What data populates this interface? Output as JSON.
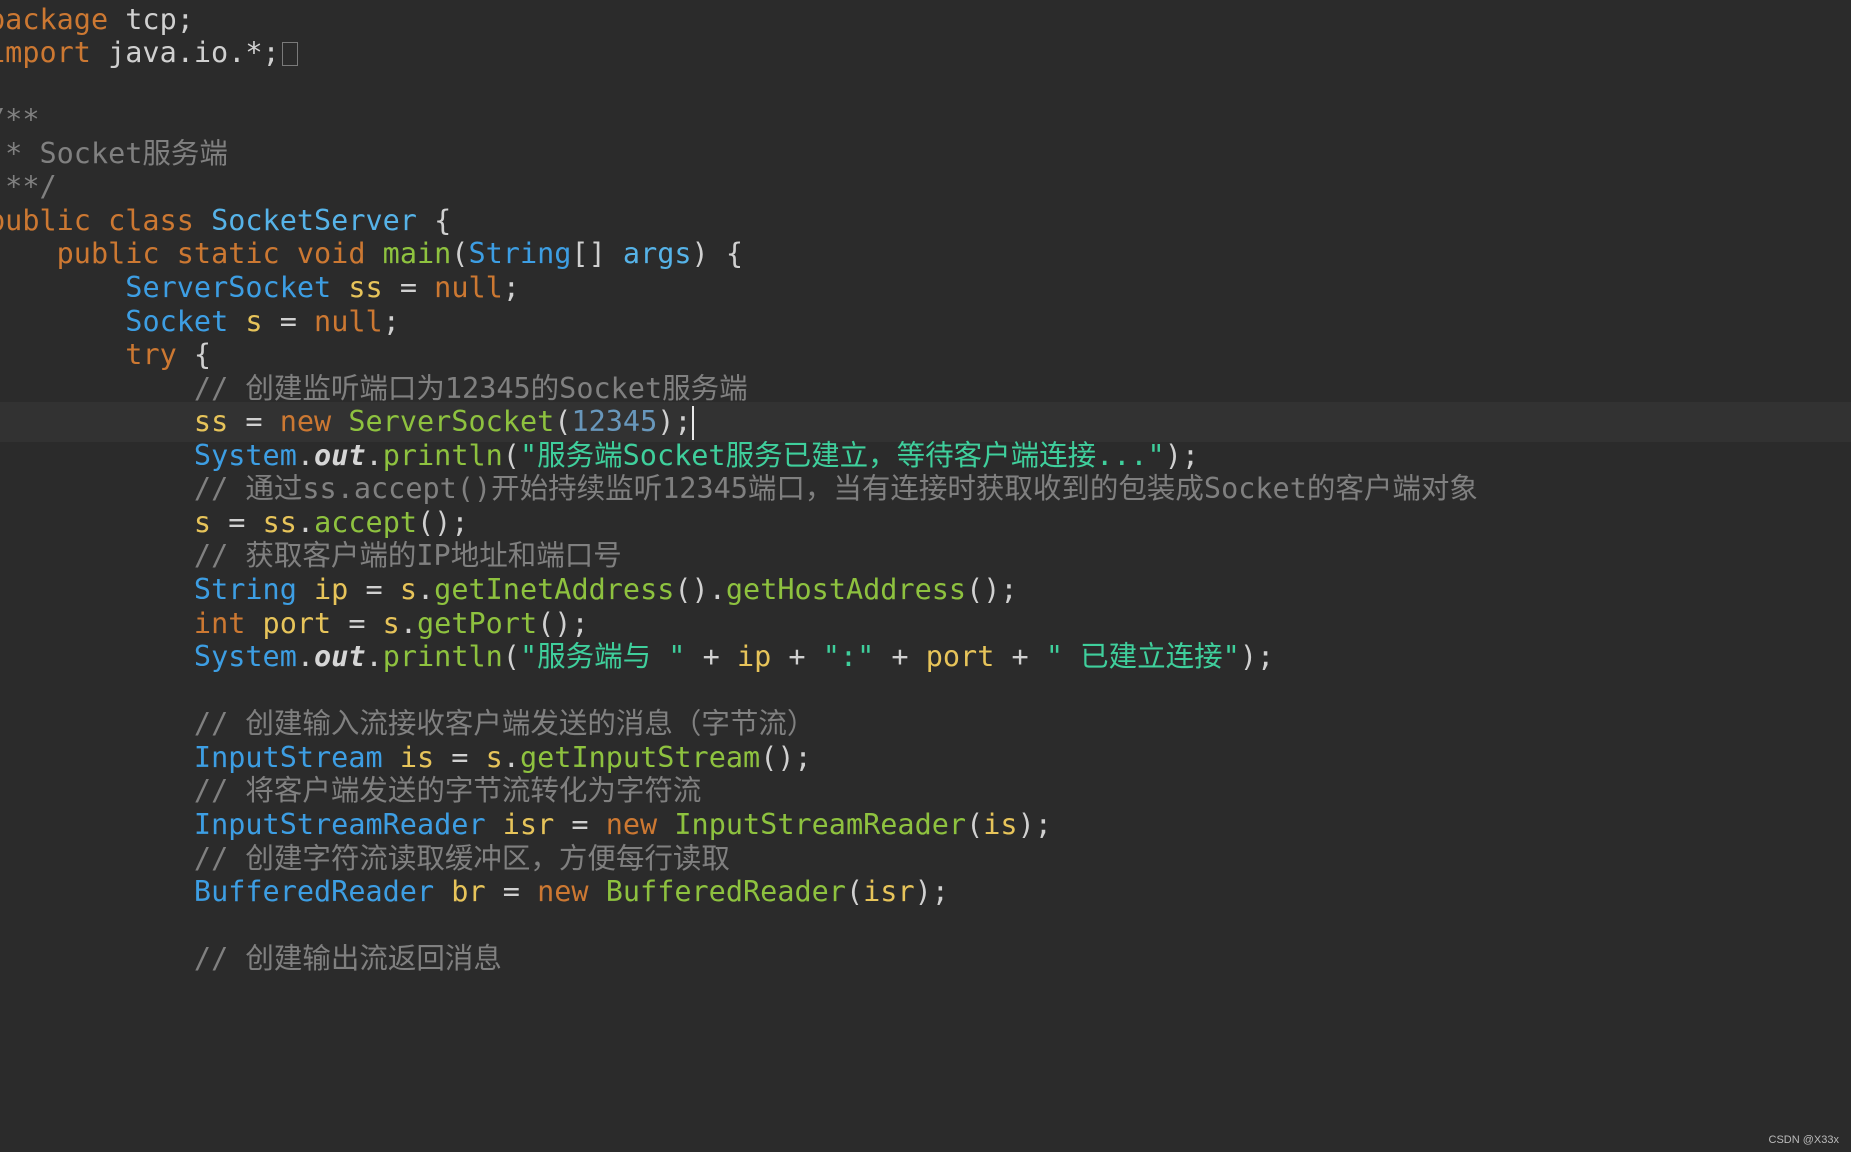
{
  "editor": {
    "lines": [
      {
        "indent": "",
        "tokens": [
          {
            "c": "kw",
            "t": "package"
          },
          {
            "c": "plain",
            "t": " tcp;"
          }
        ]
      },
      {
        "indent": "",
        "tokens": [
          {
            "c": "kw",
            "t": "import"
          },
          {
            "c": "plain",
            "t": " java.io.*;"
          }
        ],
        "fold": true
      },
      {
        "indent": "",
        "tokens": []
      },
      {
        "indent": "",
        "tokens": [
          {
            "c": "cmt",
            "t": "/**"
          }
        ]
      },
      {
        "indent": "",
        "tokens": [
          {
            "c": "cmt",
            "t": " * Socket服务端"
          }
        ]
      },
      {
        "indent": "",
        "tokens": [
          {
            "c": "cmt",
            "t": " **/"
          }
        ]
      },
      {
        "indent": "",
        "tokens": [
          {
            "c": "kw",
            "t": "public class "
          },
          {
            "c": "cls",
            "t": "SocketServer"
          },
          {
            "c": "plain",
            "t": " {"
          }
        ]
      },
      {
        "indent": "    ",
        "tokens": [
          {
            "c": "kw",
            "t": "public static void "
          },
          {
            "c": "fn",
            "t": "main"
          },
          {
            "c": "plain",
            "t": "("
          },
          {
            "c": "typ",
            "t": "String"
          },
          {
            "c": "plain",
            "t": "[] "
          },
          {
            "c": "cls",
            "t": "args"
          },
          {
            "c": "plain",
            "t": ") {"
          }
        ]
      },
      {
        "indent": "        ",
        "tokens": [
          {
            "c": "typ",
            "t": "ServerSocket"
          },
          {
            "c": "var",
            "t": " ss "
          },
          {
            "c": "plain",
            "t": "= "
          },
          {
            "c": "kw",
            "t": "null"
          },
          {
            "c": "plain",
            "t": ";"
          }
        ]
      },
      {
        "indent": "        ",
        "tokens": [
          {
            "c": "typ",
            "t": "Socket"
          },
          {
            "c": "var",
            "t": " s "
          },
          {
            "c": "plain",
            "t": "= "
          },
          {
            "c": "kw",
            "t": "null"
          },
          {
            "c": "plain",
            "t": ";"
          }
        ]
      },
      {
        "indent": "        ",
        "tokens": [
          {
            "c": "kw",
            "t": "try"
          },
          {
            "c": "plain",
            "t": " {"
          }
        ]
      },
      {
        "indent": "            ",
        "tokens": [
          {
            "c": "cmt",
            "t": "// 创建监听端口为12345的Socket服务端"
          }
        ]
      },
      {
        "indent": "            ",
        "tokens": [
          {
            "c": "var",
            "t": "ss "
          },
          {
            "c": "plain",
            "t": "= "
          },
          {
            "c": "kw",
            "t": "new "
          },
          {
            "c": "fn",
            "t": "ServerSocket"
          },
          {
            "c": "plain",
            "t": "("
          },
          {
            "c": "num",
            "t": "12345"
          },
          {
            "c": "plain",
            "t": ");"
          }
        ],
        "current": true
      },
      {
        "indent": "            ",
        "tokens": [
          {
            "c": "typ",
            "t": "System"
          },
          {
            "c": "plain",
            "t": "."
          },
          {
            "c": "ital",
            "t": "out"
          },
          {
            "c": "plain",
            "t": "."
          },
          {
            "c": "fn",
            "t": "println"
          },
          {
            "c": "plain",
            "t": "("
          },
          {
            "c": "str",
            "t": "\"服务端Socket服务已建立，等待客户端连接...\""
          },
          {
            "c": "plain",
            "t": ");"
          }
        ]
      },
      {
        "indent": "            ",
        "tokens": [
          {
            "c": "cmt",
            "t": "// 通过ss.accept()开始持续监听12345端口，当有连接时获取收到的包装成Socket的客户端对象"
          }
        ]
      },
      {
        "indent": "            ",
        "tokens": [
          {
            "c": "var",
            "t": "s "
          },
          {
            "c": "plain",
            "t": "= "
          },
          {
            "c": "var",
            "t": "ss"
          },
          {
            "c": "plain",
            "t": "."
          },
          {
            "c": "fn",
            "t": "accept"
          },
          {
            "c": "plain",
            "t": "();"
          }
        ]
      },
      {
        "indent": "            ",
        "tokens": [
          {
            "c": "cmt",
            "t": "// 获取客户端的IP地址和端口号"
          }
        ]
      },
      {
        "indent": "            ",
        "tokens": [
          {
            "c": "typ",
            "t": "String"
          },
          {
            "c": "var",
            "t": " ip "
          },
          {
            "c": "plain",
            "t": "= "
          },
          {
            "c": "var",
            "t": "s"
          },
          {
            "c": "plain",
            "t": "."
          },
          {
            "c": "fn",
            "t": "getInetAddress"
          },
          {
            "c": "plain",
            "t": "()."
          },
          {
            "c": "fn",
            "t": "getHostAddress"
          },
          {
            "c": "plain",
            "t": "();"
          }
        ]
      },
      {
        "indent": "            ",
        "tokens": [
          {
            "c": "kw",
            "t": "int"
          },
          {
            "c": "var",
            "t": " port "
          },
          {
            "c": "plain",
            "t": "= "
          },
          {
            "c": "var",
            "t": "s"
          },
          {
            "c": "plain",
            "t": "."
          },
          {
            "c": "fn",
            "t": "getPort"
          },
          {
            "c": "plain",
            "t": "();"
          }
        ]
      },
      {
        "indent": "            ",
        "tokens": [
          {
            "c": "typ",
            "t": "System"
          },
          {
            "c": "plain",
            "t": "."
          },
          {
            "c": "ital",
            "t": "out"
          },
          {
            "c": "plain",
            "t": "."
          },
          {
            "c": "fn",
            "t": "println"
          },
          {
            "c": "plain",
            "t": "("
          },
          {
            "c": "str",
            "t": "\"服务端与 \""
          },
          {
            "c": "plain",
            "t": " + "
          },
          {
            "c": "var",
            "t": "ip"
          },
          {
            "c": "plain",
            "t": " + "
          },
          {
            "c": "str",
            "t": "\":\""
          },
          {
            "c": "plain",
            "t": " + "
          },
          {
            "c": "var",
            "t": "port"
          },
          {
            "c": "plain",
            "t": " + "
          },
          {
            "c": "str",
            "t": "\" 已建立连接\""
          },
          {
            "c": "plain",
            "t": ");"
          }
        ]
      },
      {
        "indent": "",
        "tokens": []
      },
      {
        "indent": "            ",
        "tokens": [
          {
            "c": "cmt",
            "t": "// 创建输入流接收客户端发送的消息（字节流）"
          }
        ]
      },
      {
        "indent": "            ",
        "tokens": [
          {
            "c": "typ",
            "t": "InputStream"
          },
          {
            "c": "var",
            "t": " is "
          },
          {
            "c": "plain",
            "t": "= "
          },
          {
            "c": "var",
            "t": "s"
          },
          {
            "c": "plain",
            "t": "."
          },
          {
            "c": "fn",
            "t": "getInputStream"
          },
          {
            "c": "plain",
            "t": "();"
          }
        ]
      },
      {
        "indent": "            ",
        "tokens": [
          {
            "c": "cmt",
            "t": "// 将客户端发送的字节流转化为字符流"
          }
        ]
      },
      {
        "indent": "            ",
        "tokens": [
          {
            "c": "typ",
            "t": "InputStreamReader"
          },
          {
            "c": "var",
            "t": " isr "
          },
          {
            "c": "plain",
            "t": "= "
          },
          {
            "c": "kw",
            "t": "new "
          },
          {
            "c": "fn",
            "t": "InputStreamReader"
          },
          {
            "c": "plain",
            "t": "("
          },
          {
            "c": "var",
            "t": "is"
          },
          {
            "c": "plain",
            "t": ");"
          }
        ]
      },
      {
        "indent": "            ",
        "tokens": [
          {
            "c": "cmt",
            "t": "// 创建字符流读取缓冲区，方便每行读取"
          }
        ]
      },
      {
        "indent": "            ",
        "tokens": [
          {
            "c": "typ",
            "t": "BufferedReader"
          },
          {
            "c": "var",
            "t": " br "
          },
          {
            "c": "plain",
            "t": "= "
          },
          {
            "c": "kw",
            "t": "new "
          },
          {
            "c": "fn",
            "t": "BufferedReader"
          },
          {
            "c": "plain",
            "t": "("
          },
          {
            "c": "var",
            "t": "isr"
          },
          {
            "c": "plain",
            "t": ");"
          }
        ]
      },
      {
        "indent": "",
        "tokens": []
      },
      {
        "indent": "            ",
        "tokens": [
          {
            "c": "cmt",
            "t": "// 创建输出流返回消息"
          }
        ]
      }
    ]
  },
  "watermark": "CSDN @X33x",
  "colors": {
    "background": "#2b2b2b",
    "current_line": "#323232",
    "keyword": "#cc7832",
    "type": "#3d9ee3",
    "method": "#8ec23f",
    "variable": "#e7c45a",
    "string": "#3fcf9c",
    "number": "#6897bb",
    "comment": "#808080"
  },
  "icons": {
    "fold_marker": "fold-marker-icon",
    "caret": "text-caret-icon"
  }
}
